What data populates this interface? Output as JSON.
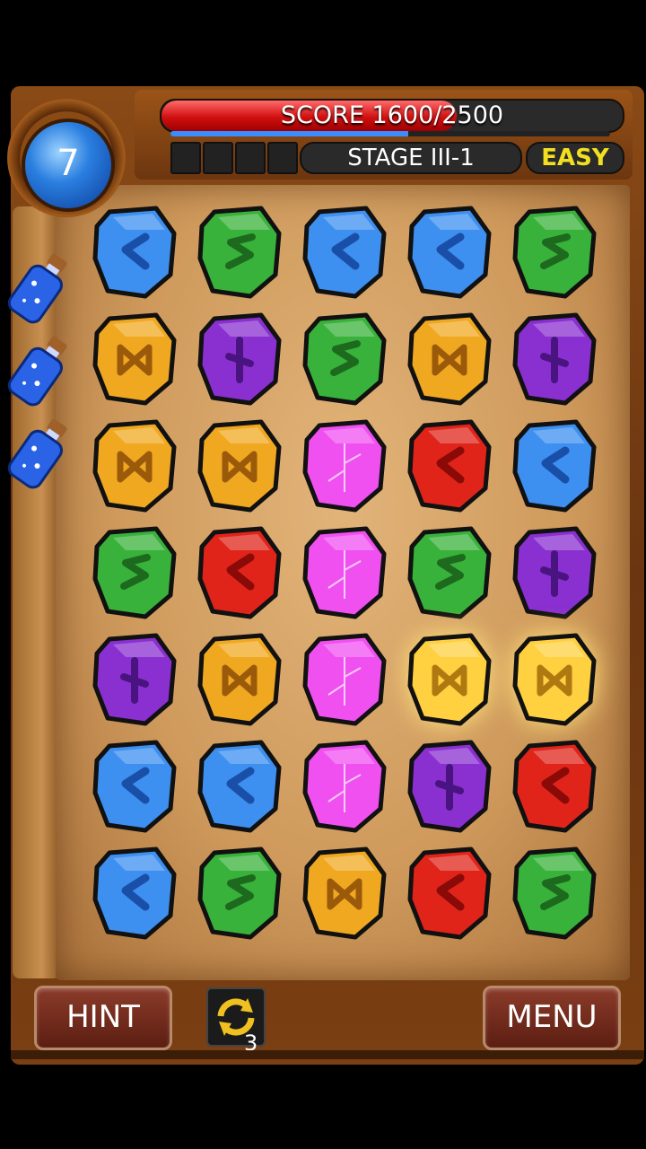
{
  "hud": {
    "moves": "7",
    "score_text": "SCORE 1600/2500",
    "score_current": 1600,
    "score_target": 2500,
    "score_fill_fraction": 0.64,
    "progress_fraction": 0.54,
    "stage": "STAGE III-1",
    "difficulty": "EASY"
  },
  "buttons": {
    "hint": "HINT",
    "menu": "MENU",
    "shuffle_count": "3"
  },
  "potions": {
    "count": 3,
    "icon": "potion-bottle-icon"
  },
  "colors": {
    "blue": "#3d8ff0",
    "green": "#38b23a",
    "yellow": "#f0a820",
    "purple": "#8a2fd0",
    "red": "#e0241a",
    "magenta": "#f050f0"
  },
  "board": {
    "columns": 5,
    "rows": 7,
    "grid": [
      [
        "blue",
        "green",
        "blue",
        "blue",
        "green"
      ],
      [
        "yellow",
        "purple",
        "green",
        "yellow",
        "purple"
      ],
      [
        "yellow",
        "yellow",
        "magenta",
        "red",
        "blue"
      ],
      [
        "green",
        "red",
        "magenta",
        "green",
        "purple"
      ],
      [
        "purple",
        "yellow",
        "magenta",
        "yellow-glow",
        "yellow-glow"
      ],
      [
        "blue",
        "blue",
        "magenta",
        "purple",
        "red"
      ],
      [
        "blue",
        "green",
        "yellow",
        "red",
        "green"
      ]
    ]
  }
}
